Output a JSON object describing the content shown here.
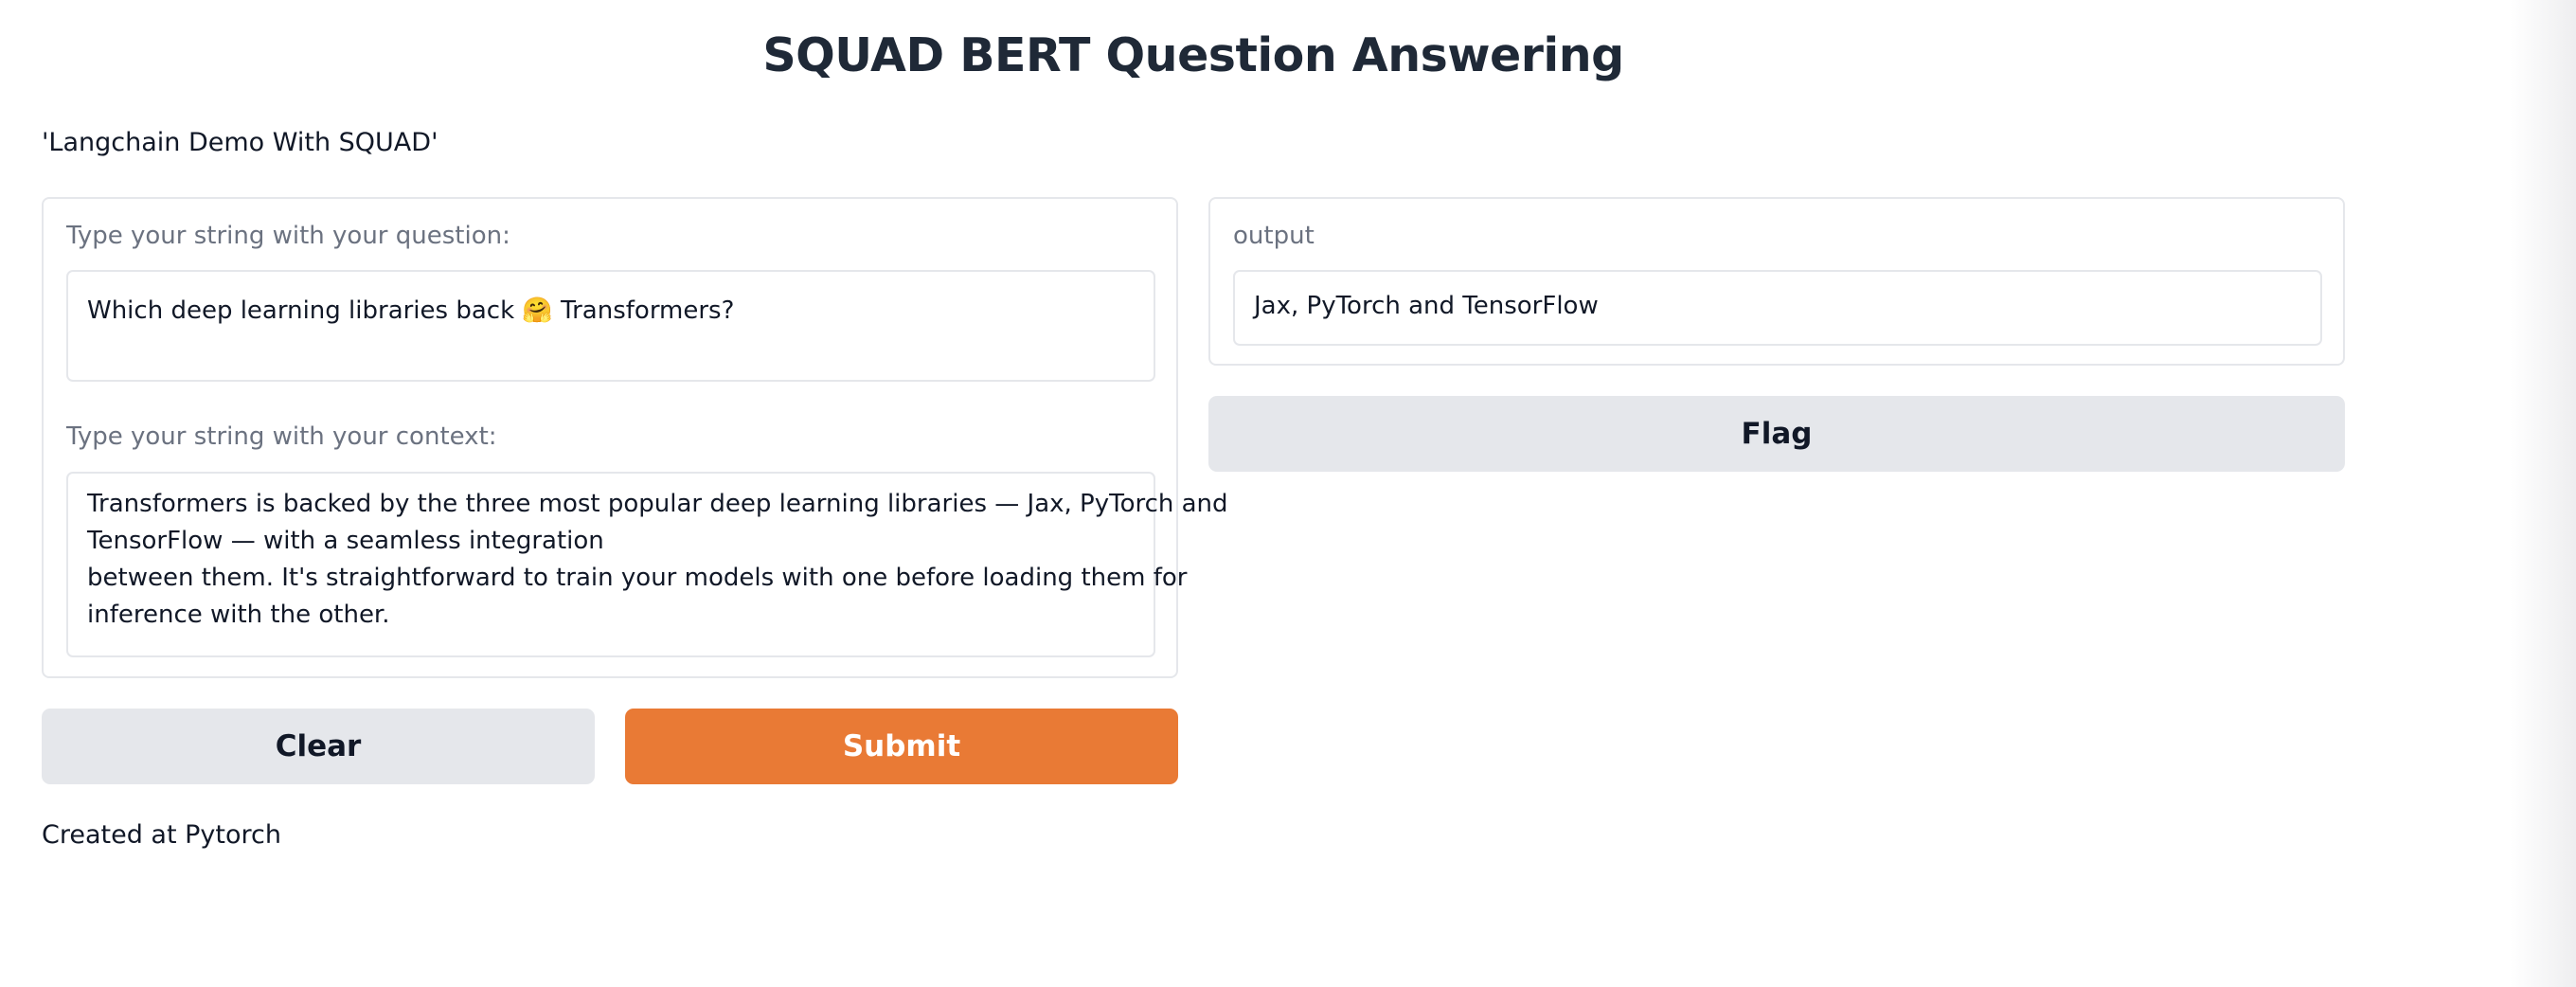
{
  "header": {
    "title": "SQUAD BERT Question Answering",
    "description": "'Langchain Demo With SQUAD'"
  },
  "inputs": {
    "question": {
      "label": "Type your string with your question:",
      "value_before_emoji": "Which deep learning libraries back ",
      "emoji": "🤗",
      "value_after_emoji": " Transformers?"
    },
    "context": {
      "label": "Type your string with your context:",
      "lines": [
        "Transformers is backed by the three most popular deep learning libraries — Jax, PyTorch and",
        "TensorFlow — with a seamless integration",
        "between them. It's straightforward to train your models with one before loading them for",
        "inference with the other."
      ]
    }
  },
  "output": {
    "label": "output",
    "value": "Jax, PyTorch and TensorFlow"
  },
  "buttons": {
    "clear": "Clear",
    "submit": "Submit",
    "flag": "Flag"
  },
  "footer": {
    "text": "Created at Pytorch"
  },
  "colors": {
    "primary_button": "#e97a35",
    "secondary_button": "#e5e7eb",
    "border": "#e5e7eb",
    "label_text": "#6b7280"
  }
}
